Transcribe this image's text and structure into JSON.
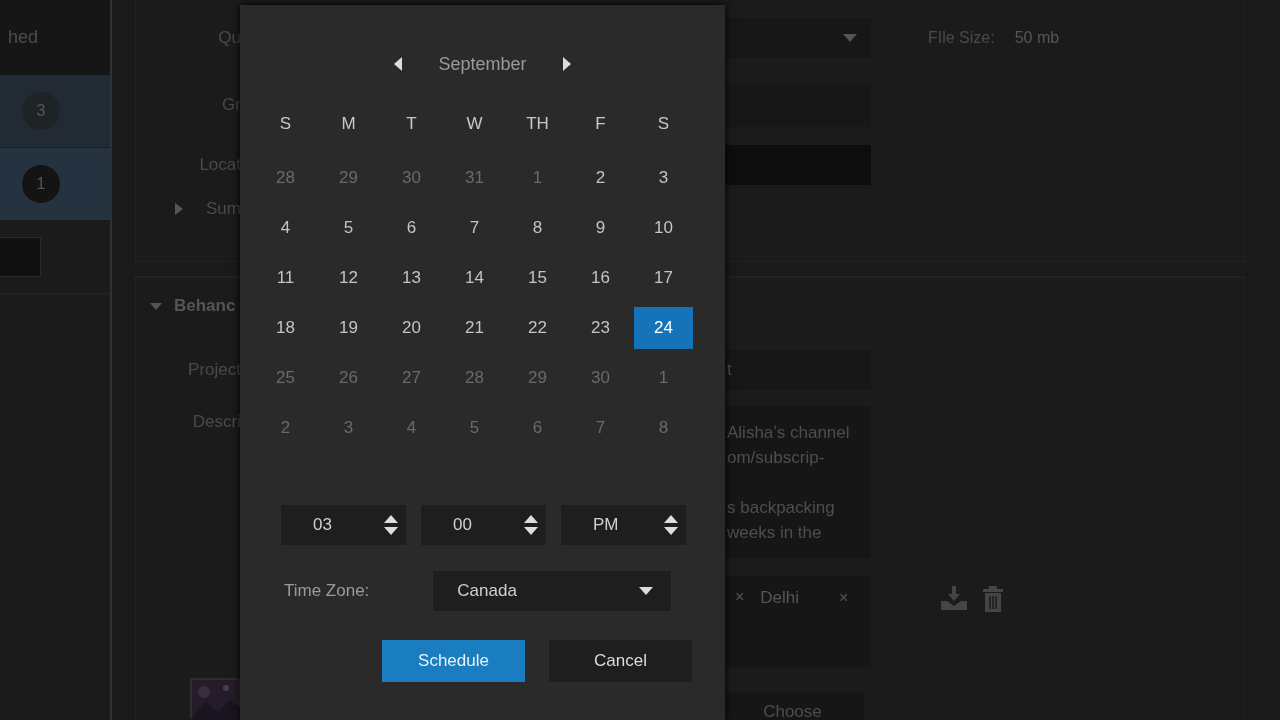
{
  "sidebar": {
    "header": "hed",
    "items": [
      {
        "count": "3",
        "selected": false
      },
      {
        "count": "1",
        "selected": true
      }
    ]
  },
  "details": {
    "labels": [
      "Qu",
      "Gr",
      "Locat"
    ],
    "summary": {
      "label": "Sum",
      "expanded": false
    },
    "file_size": {
      "label": "FIle Size:",
      "value": "50 mb"
    }
  },
  "behance": {
    "title": "Behanc",
    "expanded": true,
    "project_label": "Project",
    "project_placeholder": "t",
    "description_label": "Descri",
    "description_paragraphs": [
      [
        "Alisha’s channel",
        "om/subscrip-"
      ],
      [
        "s backpacking",
        "weeks in the"
      ]
    ],
    "tags": [
      {
        "remove": "×"
      },
      {
        "label": "Delhi",
        "remove": "×"
      }
    ],
    "choose": "Choose",
    "thumbnail": {
      "kind": "picture"
    }
  },
  "dialog": {
    "month": "September",
    "weekdays": [
      "S",
      "M",
      "T",
      "W",
      "TH",
      "F",
      "S"
    ],
    "weeks": [
      [
        {
          "day": "28",
          "muted": true,
          "selected": false
        },
        {
          "day": "29",
          "muted": true,
          "selected": false
        },
        {
          "day": "30",
          "muted": true,
          "selected": false
        },
        {
          "day": "31",
          "muted": true,
          "selected": false
        },
        {
          "day": "1",
          "muted": true,
          "selected": false
        },
        {
          "day": "2",
          "muted": false,
          "selected": false
        },
        {
          "day": "3",
          "muted": false,
          "selected": false
        }
      ],
      [
        {
          "day": "4",
          "muted": false,
          "selected": false
        },
        {
          "day": "5",
          "muted": false,
          "selected": false
        },
        {
          "day": "6",
          "muted": false,
          "selected": false
        },
        {
          "day": "7",
          "muted": false,
          "selected": false
        },
        {
          "day": "8",
          "muted": false,
          "selected": false
        },
        {
          "day": "9",
          "muted": false,
          "selected": false
        },
        {
          "day": "10",
          "muted": false,
          "selected": false
        }
      ],
      [
        {
          "day": "11",
          "muted": false,
          "selected": false
        },
        {
          "day": "12",
          "muted": false,
          "selected": false
        },
        {
          "day": "13",
          "muted": false,
          "selected": false
        },
        {
          "day": "14",
          "muted": false,
          "selected": false
        },
        {
          "day": "15",
          "muted": false,
          "selected": false
        },
        {
          "day": "16",
          "muted": false,
          "selected": false
        },
        {
          "day": "17",
          "muted": false,
          "selected": false
        }
      ],
      [
        {
          "day": "18",
          "muted": false,
          "selected": false
        },
        {
          "day": "19",
          "muted": false,
          "selected": false
        },
        {
          "day": "20",
          "muted": false,
          "selected": false
        },
        {
          "day": "21",
          "muted": false,
          "selected": false
        },
        {
          "day": "22",
          "muted": false,
          "selected": false
        },
        {
          "day": "23",
          "muted": false,
          "selected": false
        },
        {
          "day": "24",
          "muted": false,
          "selected": true
        }
      ],
      [
        {
          "day": "25",
          "muted": true,
          "selected": false
        },
        {
          "day": "26",
          "muted": true,
          "selected": false
        },
        {
          "day": "27",
          "muted": true,
          "selected": false
        },
        {
          "day": "28",
          "muted": true,
          "selected": false
        },
        {
          "day": "29",
          "muted": true,
          "selected": false
        },
        {
          "day": "30",
          "muted": true,
          "selected": false
        },
        {
          "day": "1",
          "muted": true,
          "selected": false
        }
      ],
      [
        {
          "day": "2",
          "muted": true,
          "selected": false
        },
        {
          "day": "3",
          "muted": true,
          "selected": false
        },
        {
          "day": "4",
          "muted": true,
          "selected": false
        },
        {
          "day": "5",
          "muted": true,
          "selected": false
        },
        {
          "day": "6",
          "muted": true,
          "selected": false
        },
        {
          "day": "7",
          "muted": true,
          "selected": false
        },
        {
          "day": "8",
          "muted": true,
          "selected": false
        }
      ]
    ],
    "time": [
      "03",
      "00",
      "PM"
    ],
    "time_zone": {
      "label": "Time Zone:",
      "value": "Canada"
    },
    "buttons": [
      {
        "label": "Schedule",
        "kind": "primary"
      },
      {
        "label": "Cancel",
        "kind": "secondary"
      }
    ]
  }
}
